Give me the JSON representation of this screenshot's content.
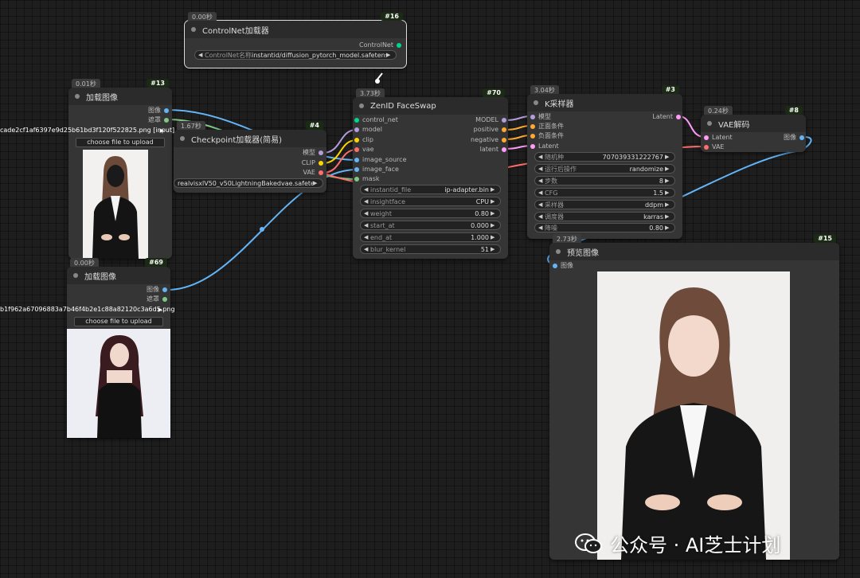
{
  "colors": {
    "model": "#b39ddb",
    "clip": "#ffd500",
    "vae": "#ff6e6e",
    "image": "#64b5f6",
    "mask": "#81c784",
    "conditioning": "#ffa931",
    "latent": "#ff9cf9",
    "controlnet": "#00d78d"
  },
  "nodes": {
    "controlnet_loader": {
      "timing": "0.00秒",
      "id": "#16",
      "title": "ControlNet加载器",
      "output": "ControlNet",
      "widget": {
        "label": "ControlNet名称",
        "value": "instantid/diffusion_pytorch_model.safetensors"
      }
    },
    "load_image_1": {
      "timing": "0.01秒",
      "id": "#13",
      "title": "加载图像",
      "outputs": [
        "图像",
        "遮罩"
      ],
      "filename": "cade2cf1af6397e9d25b61bd3f120f522825.png [input]",
      "upload_label": "choose file to upload"
    },
    "checkpoint_loader": {
      "timing": "1.67秒",
      "id": "#4",
      "title": "Checkpoint加载器(简易)",
      "outputs": [
        "模型",
        "CLIP",
        "VAE"
      ],
      "widget_value": "realvisxlV50_v50LightningBakedvae.safetensors"
    },
    "zenid_faceswap": {
      "timing": "3.73秒",
      "id": "#70",
      "title": "ZenID FaceSwap",
      "inputs": [
        "control_net",
        "model",
        "clip",
        "vae",
        "image_source",
        "image_face",
        "mask"
      ],
      "outputs": [
        "MODEL",
        "positive",
        "negative",
        "latent"
      ],
      "widgets": [
        {
          "label": "instantid_file",
          "value": "ip-adapter.bin"
        },
        {
          "label": "insightface",
          "value": "CPU"
        },
        {
          "label": "weight",
          "value": "0.80"
        },
        {
          "label": "start_at",
          "value": "0.000"
        },
        {
          "label": "end_at",
          "value": "1.000"
        },
        {
          "label": "blur_kernel",
          "value": "51"
        }
      ]
    },
    "ksampler": {
      "timing": "3.04秒",
      "id": "#3",
      "title": "K采样器",
      "inputs": [
        "模型",
        "正面条件",
        "负面条件",
        "Latent"
      ],
      "output": "Latent",
      "widgets": [
        {
          "label": "随机种",
          "value": "707039331222767"
        },
        {
          "label": "运行后操作",
          "value": "randomize"
        },
        {
          "label": "步数",
          "value": "8"
        },
        {
          "label": "CFG",
          "value": "1.5"
        },
        {
          "label": "采样器",
          "value": "ddpm"
        },
        {
          "label": "调度器",
          "value": "karras"
        },
        {
          "label": "降噪",
          "value": "0.80"
        }
      ]
    },
    "vae_decode": {
      "timing": "0.24秒",
      "id": "#8",
      "title": "VAE解码",
      "inputs": [
        "Latent",
        "VAE"
      ],
      "output": "图像"
    },
    "load_image_2": {
      "timing": "0.00秒",
      "id": "#69",
      "title": "加载图像",
      "outputs": [
        "图像",
        "遮罩"
      ],
      "filename": "b1f962a67096883a7b46f4b2e1c88a82120c3a6d5.png",
      "upload_label": "choose file to upload"
    },
    "preview_image": {
      "timing": "2.73秒",
      "id": "#15",
      "title": "预览图像",
      "input": "图像"
    }
  },
  "watermark": "公众号 · AI芝士计划"
}
